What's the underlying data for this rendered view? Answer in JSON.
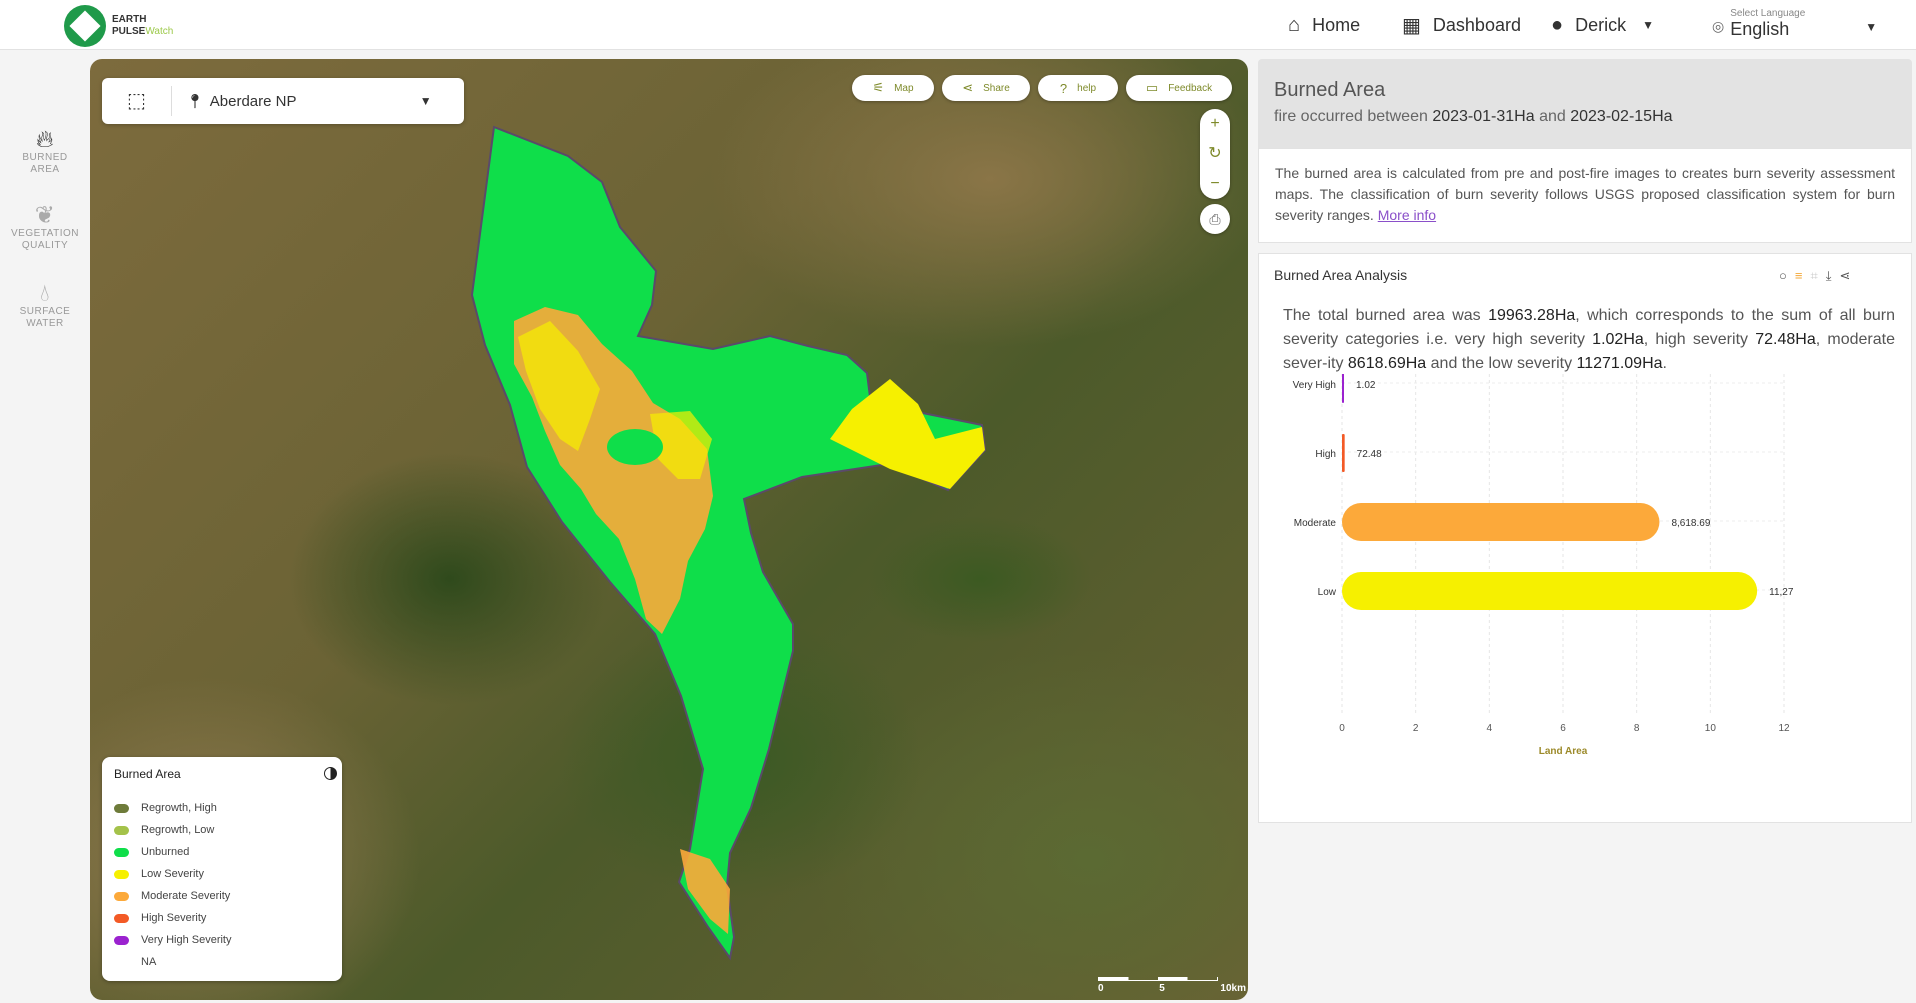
{
  "header": {
    "logo_line1": "EARTH",
    "logo_line2a": "PULSE",
    "logo_line2b": "Watch",
    "nav_home": "Home",
    "nav_dashboard": "Dashboard",
    "nav_user": "Derick",
    "lang_label": "Select Language",
    "lang_value": "English"
  },
  "rail": {
    "items": [
      {
        "label1": "BURNED",
        "label2": "AREA",
        "icon": "fire-icon"
      },
      {
        "label1": "VEGETATION",
        "label2": "QUALITY",
        "icon": "leaf-icon"
      },
      {
        "label1": "SURFACE",
        "label2": "WATER",
        "icon": "water-drop-icon"
      }
    ]
  },
  "map": {
    "place": "Aberdare NP",
    "buttons": {
      "map": "Map",
      "share": "Share",
      "help": "help",
      "feedback": "Feedback"
    },
    "zoom_in": "+",
    "reset": "↻",
    "zoom_out": "−",
    "legend_title": "Burned Area",
    "legend": [
      {
        "label": "Regrowth, High",
        "color": "#6e7b3a"
      },
      {
        "label": "Regrowth, Low",
        "color": "#a4c24a"
      },
      {
        "label": "Unburned",
        "color": "#0fde4a"
      },
      {
        "label": "Low Severity",
        "color": "#f6f000"
      },
      {
        "label": "Moderate Severity",
        "color": "#fca93a"
      },
      {
        "label": "High Severity",
        "color": "#f35a26"
      },
      {
        "label": "Very High Severity",
        "color": "#9b22cf"
      },
      {
        "label": "NA",
        "color": "#ffffff"
      }
    ],
    "scale_labels": [
      "0",
      "5",
      "10km"
    ]
  },
  "panel": {
    "title": "Burned Area",
    "subtitle_prefix": "fire occurred between",
    "date_from": "2023-01-31Ha",
    "subtitle_and": "and",
    "date_to": "2023-02-15Ha",
    "description": "The burned area is calculated from pre and post-fire images to creates burn severity assessment maps. The classification of burn severity follows USGS proposed classification system for burn severity ranges.",
    "more_info": "More info",
    "analysis_title": "Burned Area Analysis",
    "summary": {
      "p1": "The total burned area was",
      "total": "19963.28Ha",
      "p2": ", which corresponds to the sum of all burn severity categories i.e. very high severity",
      "very_high": "1.02Ha",
      "p3": ", high severity",
      "high": "72.48Ha",
      "p4": ", moderate sever-ity",
      "moderate": "8618.69Ha",
      "p5": "and the low severity",
      "low": "11271.09Ha",
      "p6": "."
    }
  },
  "chart_data": {
    "type": "bar",
    "orientation": "horizontal",
    "categories": [
      "Very High",
      "High",
      "Moderate",
      "Low"
    ],
    "values": [
      1.02,
      72.48,
      8618.69,
      11271.09
    ],
    "value_labels": [
      "1.02",
      "72.48",
      "8,618.69",
      "11,27"
    ],
    "colors": [
      "#9b22cf",
      "#f35a26",
      "#fca93a",
      "#f6f000"
    ],
    "xticks": [
      "0",
      "2",
      "4",
      "6",
      "8",
      "10",
      "12"
    ],
    "xlim": [
      0,
      12000
    ],
    "xlabel": "Land Area",
    "grid": true
  }
}
